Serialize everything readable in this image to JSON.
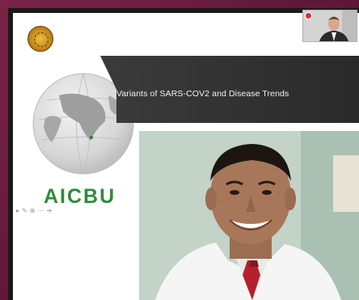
{
  "slide": {
    "title": "Variants of SARS-COV2 and Disease Trends",
    "brand": "AICBU",
    "toolbar_icons": [
      "pointer-icon",
      "pen-icon",
      "zoom-icon",
      "menu-icon",
      "next-icon"
    ]
  },
  "colors": {
    "title_band": "#333333",
    "brand_green": "#2e8b3a",
    "outer_frame": "#6a1a3e"
  }
}
